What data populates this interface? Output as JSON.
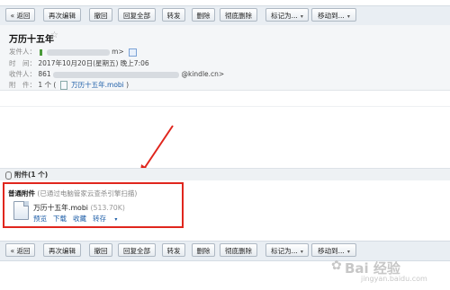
{
  "toolbar": {
    "back": "« 返回",
    "reedit": "再次编辑",
    "recall": "撤回",
    "reply_all": "回复全部",
    "forward": "转发",
    "delete": "删除",
    "perm_delete": "彻底删除",
    "mark_as": "标记为...",
    "move_to": "移动到...",
    "arrow": "▾"
  },
  "email": {
    "subject": "万历十五年",
    "star": "☆",
    "sender_label": "发件人：",
    "sender_tail": "m>",
    "time_label": "时　间：",
    "time_value": "2017年10月20日(星期五) 晚上7:06",
    "recipient_label": "收件人：",
    "recipient_prefix": "861",
    "recipient_domain": "@kindle.cn>",
    "attach_label": "附　件：",
    "attach_count": "1 个 (",
    "attach_file": "万历十五年.mobi",
    "attach_close": ")"
  },
  "attachments": {
    "title": "附件(1 个)",
    "normal_label": "普通附件",
    "scan_note": "(已通过电脑管家云查杀引擎扫描)",
    "file_name": "万历十五年.mobi",
    "file_size": "(513.70K)",
    "preview": "预览",
    "download": "下载",
    "collect": "收藏",
    "save_to": "转存",
    "arrow": "▾"
  },
  "watermark": {
    "text": "Bai 经验",
    "sub": "jingyan.baidu.com"
  },
  "colors": {
    "annotation_red": "#e0261d",
    "link_blue": "#1d5ea8"
  }
}
